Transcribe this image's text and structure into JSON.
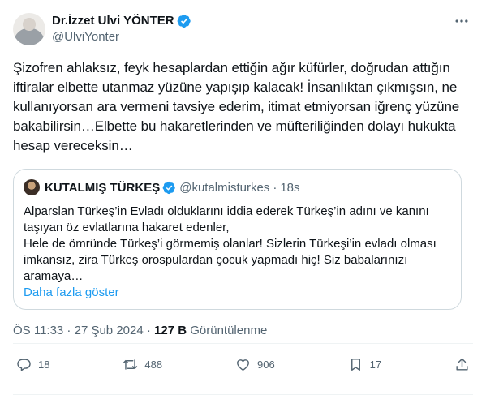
{
  "author": {
    "display_name": "Dr.İzzet Ulvi YÖNTER",
    "handle": "@UlviYonter"
  },
  "tweet": {
    "text": "Şizofren ahlaksız, feyk hesaplardan ettiğin ağır küfürler,  doğrudan attığın iftiralar elbette utanmaz yüzüne yapışıp kalacak! İnsanlıktan çıkmışsın, ne kullanıyorsan ara vermeni tavsiye ederim, itimat etmiyorsan iğrenç yüzüne bakabilirsin…Elbette bu hakaretlerinden ve müfteriliğinden dolayı hukukta hesap vereceksin…"
  },
  "quote": {
    "display_name": "KUTALMIŞ TÜRKEŞ",
    "handle": "@kutalmisturkes",
    "separator": "·",
    "time": "18s",
    "text": "Alparslan Türkeş’in Evladı olduklarını iddia ederek Türkeş’in  adını ve kanını taşıyan öz evlatlarına hakaret edenler,\nHele de ömründe Türkeş’i  görmemiş olanlar! Sizlerin Türkeşi’in evladı olması imkansız, zira Türkeş orospulardan çocuk yapmadı hiç! Siz babalarınızı aramaya…",
    "show_more": "Daha fazla göster"
  },
  "meta": {
    "time": "ÖS 11:33",
    "sep1": " · ",
    "date": "27 Şub 2024",
    "sep2": " · ",
    "views": "127 B",
    "views_label": " Görüntülenme"
  },
  "actions": {
    "replies": "18",
    "reposts": "488",
    "likes": "906",
    "bookmarks": "17"
  },
  "icons": {
    "verified": "verified-badge-icon",
    "more": "more-dots-icon",
    "reply": "reply-icon",
    "repost": "repost-icon",
    "like": "heart-icon",
    "bookmark": "bookmark-icon",
    "share": "share-icon"
  },
  "colors": {
    "accent": "#1d9bf0",
    "secondary_text": "#536471",
    "border": "#cfd9de"
  }
}
